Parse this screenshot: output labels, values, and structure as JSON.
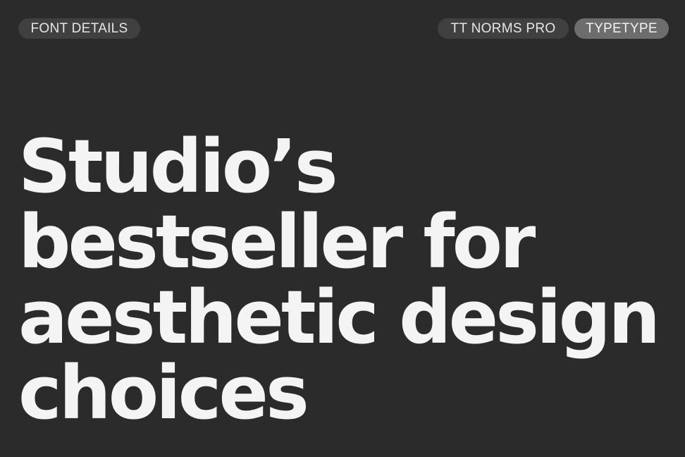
{
  "tags": {
    "left": "FONT DETAILS",
    "font_name": "TT NORMS PRO",
    "foundry": "TYPETYPE"
  },
  "headline": {
    "lines": [
      "Studio’s",
      "bestseller for",
      "aesthetic design",
      "choices"
    ]
  },
  "colors": {
    "background": "#2b2b2b",
    "text": "#f4f4f4",
    "pill_dark": "#404040",
    "pill_light": "#6d6d6d"
  }
}
